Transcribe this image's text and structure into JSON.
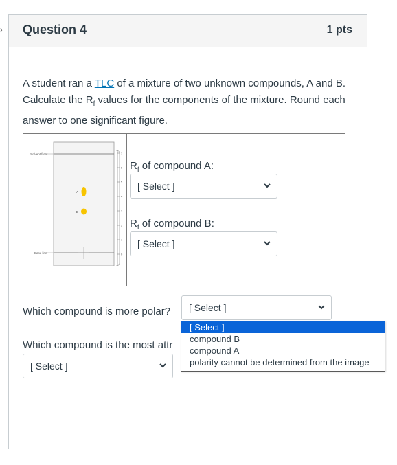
{
  "question": {
    "title": "Question 4",
    "points": "1 pts",
    "prompt_pre": "A student ran a ",
    "prompt_link": "TLC",
    "prompt_mid": " of a mixture of two unknown compounds, A and B.  Calculate the R",
    "prompt_sub": "f",
    "prompt_post": " values for the components of the mixture.  Round each answer to one significant figure."
  },
  "tlc": {
    "solvent_front_label": "Solvent front",
    "base_line_label": "Base line",
    "spot_a_label": "A",
    "spot_b_label": "B",
    "ruler_ticks": [
      "7",
      "6",
      "5",
      "4",
      "3",
      "2",
      "1",
      "0"
    ],
    "spot_color": "#f7c400"
  },
  "rf_a": {
    "label_pre": "R",
    "label_sub": "f",
    "label_post": " of compound A:",
    "select_value": "[ Select ]"
  },
  "rf_b": {
    "label_pre": "R",
    "label_sub": "f",
    "label_post": " of compound B:",
    "select_value": "[ Select ]"
  },
  "polar_q": {
    "text": "Which compound is more polar?",
    "select_value": "[ Select ]"
  },
  "attracted_q": {
    "text": "Which compound is the most attr",
    "select_value": "[ Select ]"
  },
  "dropdown": {
    "options": [
      "[ Select ]",
      "compound B",
      "compound A",
      "polarity cannot be determined from the image"
    ],
    "highlight_color": "#0a64d8"
  }
}
